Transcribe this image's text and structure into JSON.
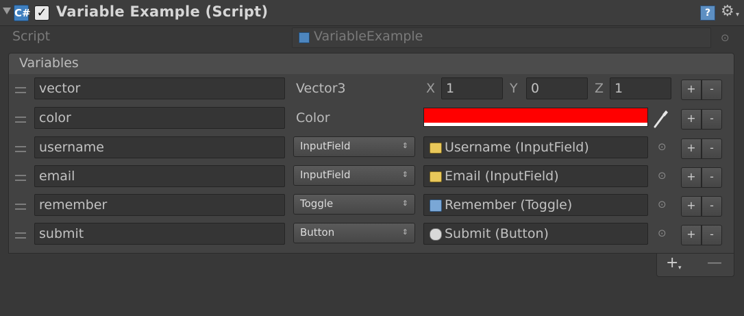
{
  "header": {
    "script_icon_glyph": "C#",
    "check_glyph": "✓",
    "title": "Variable Example (Script)",
    "help_glyph": "?",
    "gear_glyph": "⚙",
    "caret_glyph": "▾"
  },
  "script_row": {
    "label": "Script",
    "value": "VariableExample",
    "picker_glyph": "⊙"
  },
  "list": {
    "title": "Variables",
    "plus_label": "+",
    "minus_label": "-",
    "rows": [
      {
        "name": "vector",
        "type": "Vector3",
        "x_label": "X",
        "x": "1",
        "y_label": "Y",
        "y": "0",
        "z_label": "Z",
        "z": "1"
      },
      {
        "name": "color",
        "type": "Color",
        "color": "#ff0000"
      },
      {
        "name": "username",
        "type": "InputField",
        "value": "Username (InputField)",
        "icon": "inputfield-icon"
      },
      {
        "name": "email",
        "type": "InputField",
        "value": "Email (InputField)",
        "icon": "inputfield-icon"
      },
      {
        "name": "remember",
        "type": "Toggle",
        "value": "Remember (Toggle)",
        "icon": "toggle-icon"
      },
      {
        "name": "submit",
        "type": "Button",
        "value": "Submit (Button)",
        "icon": "button-icon"
      }
    ],
    "dropdown_arrow": "⇕",
    "picker_glyph": "⊙"
  },
  "footer": {
    "add_label": "+",
    "add_caret": "▾",
    "remove_label": "—"
  }
}
